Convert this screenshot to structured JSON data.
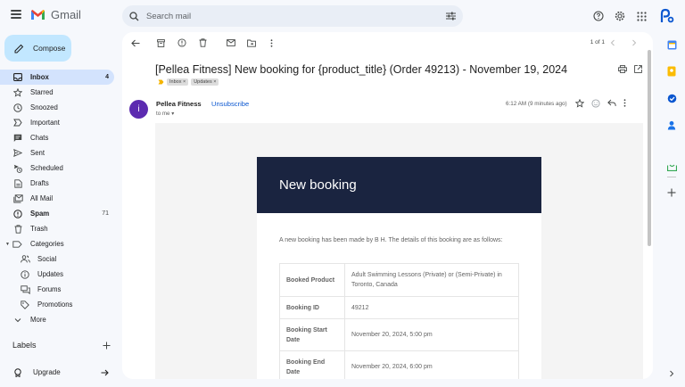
{
  "app": {
    "name": "Gmail"
  },
  "search": {
    "placeholder": "Search mail"
  },
  "sidebar": {
    "compose_label": "Compose",
    "items": [
      {
        "label": "Inbox",
        "count": "4",
        "icon": "inbox-icon"
      },
      {
        "label": "Starred",
        "count": "",
        "icon": "star-icon"
      },
      {
        "label": "Snoozed",
        "count": "",
        "icon": "clock-icon"
      },
      {
        "label": "Important",
        "count": "",
        "icon": "important-icon"
      },
      {
        "label": "Chats",
        "count": "",
        "icon": "chat-icon"
      },
      {
        "label": "Sent",
        "count": "",
        "icon": "send-icon"
      },
      {
        "label": "Scheduled",
        "count": "",
        "icon": "scheduled-icon"
      },
      {
        "label": "Drafts",
        "count": "",
        "icon": "draft-icon"
      },
      {
        "label": "All Mail",
        "count": "",
        "icon": "all-mail-icon"
      },
      {
        "label": "Spam",
        "count": "71",
        "icon": "spam-icon"
      },
      {
        "label": "Trash",
        "count": "",
        "icon": "trash-icon"
      },
      {
        "label": "Categories",
        "count": "",
        "icon": "label-icon"
      },
      {
        "label": "Social",
        "count": "",
        "icon": "people-icon"
      },
      {
        "label": "Updates",
        "count": "",
        "icon": "info-icon"
      },
      {
        "label": "Forums",
        "count": "",
        "icon": "forum-icon"
      },
      {
        "label": "Promotions",
        "count": "",
        "icon": "tag-icon"
      },
      {
        "label": "More",
        "count": "",
        "icon": "chevron-down-icon"
      }
    ],
    "labels_heading": "Labels",
    "upgrade_label": "Upgrade"
  },
  "toolbar": {
    "pager": "1 of 1"
  },
  "email": {
    "subject": "[Pellea Fitness] New booking for {product_title} (Order 49213) - November 19, 2024",
    "chips": [
      "Inbox ×",
      "Updates ×"
    ],
    "avatar_letter": "i",
    "sender": "Pellea Fitness",
    "unsubscribe": "Unsubscribe",
    "to": "to me ▾",
    "timestamp": "6:12 AM (9 minutes ago)",
    "body": {
      "header": "New booking",
      "intro": "A new booking has been made by B H. The details of this booking are as follows:",
      "rows": [
        {
          "key": "Booked Product",
          "value": "Adult Swimming Lessons (Private) or (Semi-Private) in Toronto, Canada"
        },
        {
          "key": "Booking ID",
          "value": "49212"
        },
        {
          "key": "Booking Start Date",
          "value": "November 20, 2024, 5:00 pm"
        },
        {
          "key": "Booking End Date",
          "value": "November 20, 2024, 6:00 pm"
        }
      ]
    }
  },
  "colors": {
    "accent": "#0b57d0",
    "compose_bg": "#c2e7ff",
    "active_nav": "#d3e3fd",
    "email_header_bg": "#1a2440",
    "avatar_bg": "#5c2bb0"
  }
}
